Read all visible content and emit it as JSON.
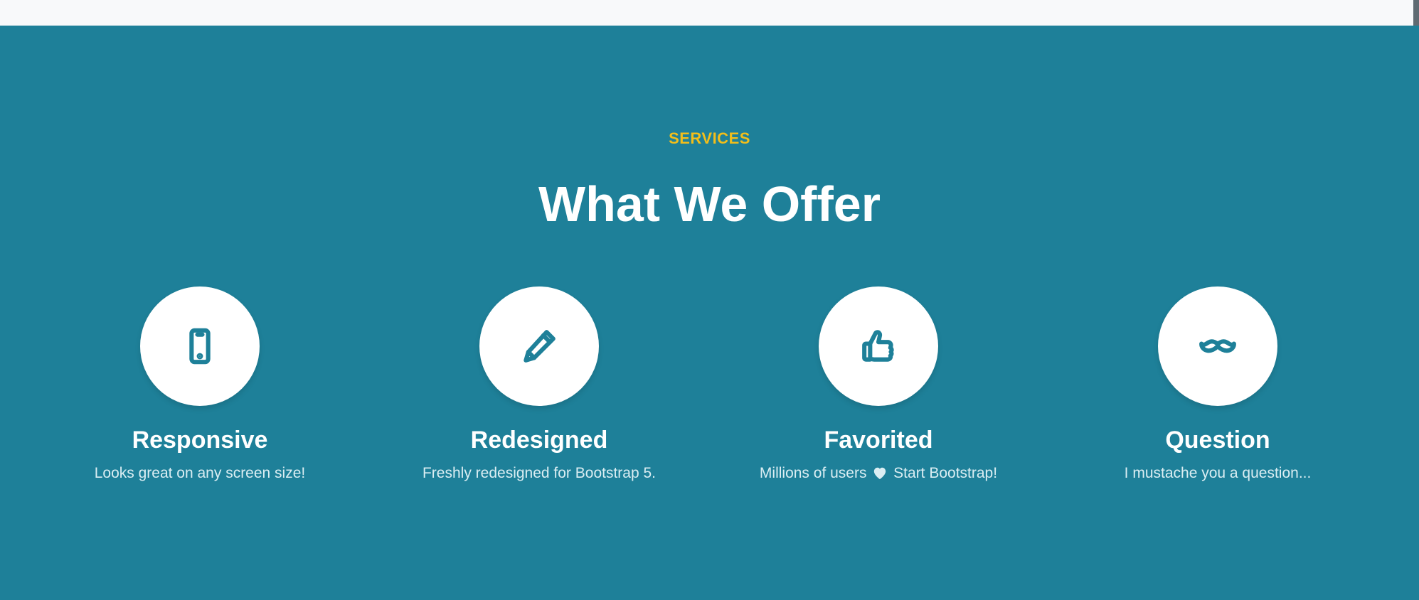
{
  "section": {
    "kicker": "SERVICES",
    "title": "What We Offer"
  },
  "services": [
    {
      "icon": "phone-icon",
      "title": "Responsive",
      "description": "Looks great on any screen size!"
    },
    {
      "icon": "pencil-icon",
      "title": "Redesigned",
      "description": "Freshly redesigned for Bootstrap 5."
    },
    {
      "icon": "thumbs-up-icon",
      "title": "Favorited",
      "description_before": "Millions of users",
      "description_after": "Start Bootstrap!"
    },
    {
      "icon": "mustache-icon",
      "title": "Question",
      "description": "I mustache you a question..."
    }
  ],
  "colors": {
    "background": "#1e8099",
    "accent": "#f2be1a",
    "circle": "#ffffff",
    "top_strip": "#f8f9fa"
  }
}
